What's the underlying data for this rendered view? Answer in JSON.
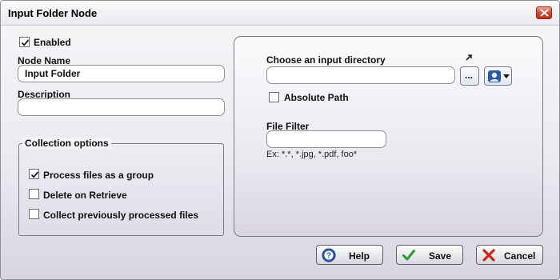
{
  "window": {
    "title": "Input Folder Node",
    "close_icon": "close-icon"
  },
  "left": {
    "enabled": {
      "label": "Enabled",
      "checked": true
    },
    "node_name": {
      "label": "Node Name",
      "value": "Input Folder"
    },
    "description": {
      "label": "Description",
      "value": ""
    },
    "collection": {
      "legend": "Collection options",
      "options": [
        {
          "label": "Process files as a group",
          "checked": true
        },
        {
          "label": "Delete on Retrieve",
          "checked": false
        },
        {
          "label": "Collect previously processed files",
          "checked": false
        }
      ]
    }
  },
  "right": {
    "directory": {
      "label": "Choose an input directory",
      "value": "",
      "browse_label": "..."
    },
    "absolute_path": {
      "label": "Absolute Path",
      "checked": false
    },
    "file_filter": {
      "label": "File Filter",
      "value": "",
      "hint": "Ex: *.*, *.jpg, *.pdf, foo*"
    }
  },
  "buttons": {
    "help": {
      "label": "Help",
      "icon": "help-icon"
    },
    "save": {
      "label": "Save",
      "icon": "checkmark-icon"
    },
    "cancel": {
      "label": "Cancel",
      "icon": "x-icon"
    }
  }
}
